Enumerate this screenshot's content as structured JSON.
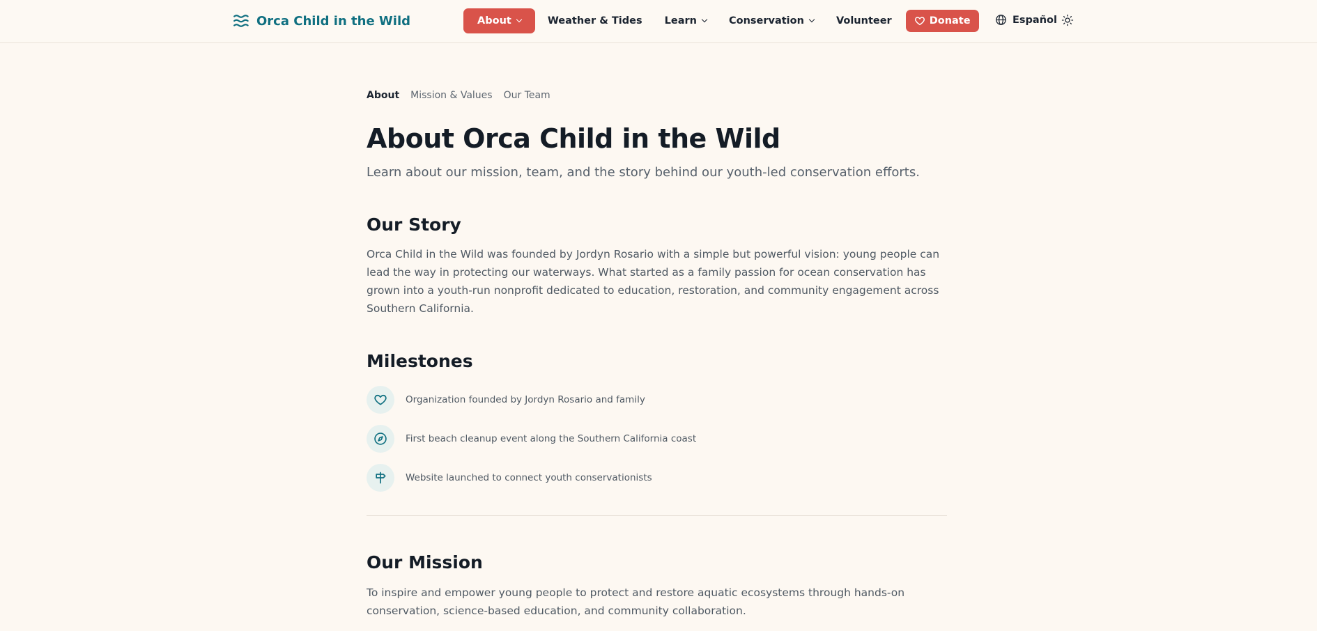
{
  "header": {
    "logo_text": "Orca Child in the Wild",
    "nav": {
      "about": "About",
      "weather": "Weather & Tides",
      "learn": "Learn",
      "conservation": "Conservation",
      "volunteer": "Volunteer",
      "donate": "Donate"
    },
    "language": "Español"
  },
  "subnav": {
    "items": [
      "About",
      "Mission & Values",
      "Our Team"
    ]
  },
  "page": {
    "title": "About Orca Child in the Wild",
    "subtitle": "Learn about our mission, team, and the story behind our youth-led conservation efforts."
  },
  "story": {
    "title": "Our Story",
    "text": "Orca Child in the Wild was founded by Jordyn Rosario with a simple but powerful vision: young people can lead the way in protecting our waterways. What started as a family passion for ocean conservation has grown into a youth-run nonprofit dedicated to education, restoration, and community engagement across Southern California."
  },
  "milestones": {
    "title": "Milestones",
    "items": [
      {
        "icon": "heart-icon",
        "text": "Organization founded by Jordyn Rosario and family"
      },
      {
        "icon": "compass-icon",
        "text": "First beach cleanup event along the Southern California coast"
      },
      {
        "icon": "signpost-icon",
        "text": "Website launched to connect youth conservationists"
      }
    ]
  },
  "mission": {
    "title": "Our Mission",
    "text": "To inspire and empower young people to protect and restore aquatic ecosystems through hands-on conservation, science-based education, and community collaboration."
  },
  "colors": {
    "brand": "#0f6f80",
    "accent": "#d9534a",
    "background": "#fdf8f2",
    "icon_bg": "#e7f1ef"
  }
}
